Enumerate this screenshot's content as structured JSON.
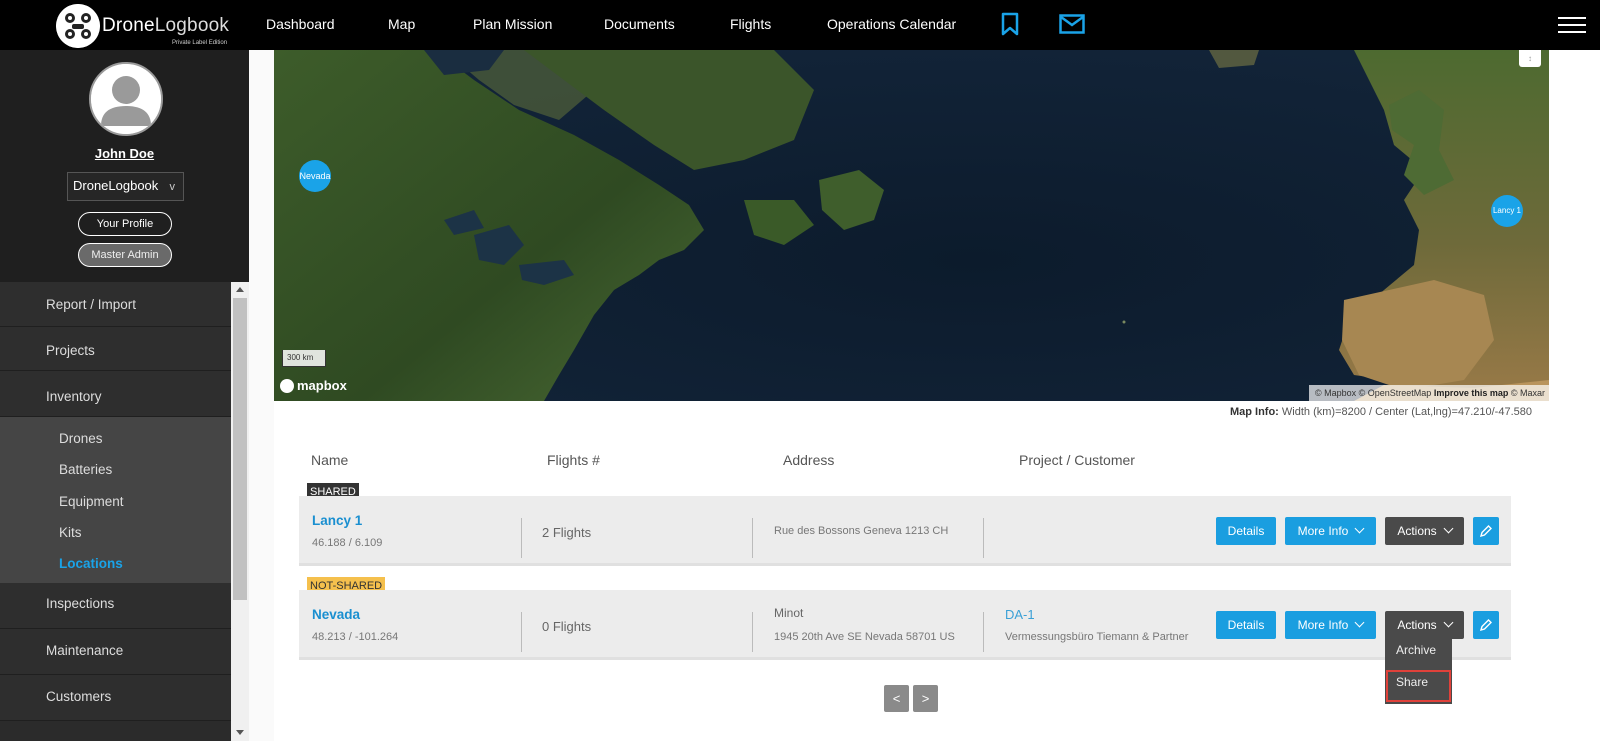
{
  "brand": {
    "name_part1": "Drone",
    "name_part2": "Logbook",
    "edition": "Private Label Edition"
  },
  "nav": {
    "items": [
      "Dashboard",
      "Map",
      "Plan Mission",
      "Documents",
      "Flights",
      "Operations Calendar"
    ]
  },
  "profile": {
    "user_name": "John Doe",
    "organization": "DroneLogbook",
    "org_chevron": "v",
    "your_profile_label": "Your Profile",
    "master_admin_label": "Master Admin"
  },
  "sidebar": {
    "items": [
      "Report / Import",
      "Projects",
      "Inventory"
    ],
    "sub_items": [
      "Drones",
      "Batteries",
      "Equipment",
      "Kits",
      "Locations"
    ],
    "active_sub_item": "Locations",
    "items_after": [
      "Inspections",
      "Maintenance",
      "Customers"
    ]
  },
  "map": {
    "markers": [
      "Nevada",
      "Lancy 1"
    ],
    "scale_label": "300 km",
    "logo_text": "mapbox",
    "attribution_plain": "© Mapbox © OpenStreetMap",
    "attribution_link": "Improve this map",
    "attribution_tail": "© Maxar",
    "compass_symbol": "↕"
  },
  "map_info": {
    "label": "Map Info:",
    "value": "Width (km)=8200 / Center (Lat,lng)=47.210/-47.580"
  },
  "table": {
    "headers": [
      "Name",
      "Flights #",
      "Address",
      "Project / Customer"
    ],
    "rows": [
      {
        "tag": "SHARED",
        "name": "Lancy 1",
        "coords": "46.188 / 6.109",
        "flights": "2 Flights",
        "address_line1": "Rue des Bossons Geneva 1213 CH",
        "address_line2": "",
        "project": "",
        "customer": ""
      },
      {
        "tag": "NOT-SHARED",
        "name": "Nevada",
        "coords": "48.213 / -101.264",
        "flights": "0 Flights",
        "address_line1": "Minot",
        "address_line2": "1945 20th Ave SE Nevada 58701 US",
        "project": "DA-1",
        "customer": "Vermessungsbüro Tiemann & Partner"
      }
    ],
    "buttons": {
      "details": "Details",
      "more_info": "More Info",
      "actions": "Actions"
    }
  },
  "actions_menu": {
    "items": [
      "Archive",
      "Share"
    ]
  },
  "pagination": {
    "prev": "<",
    "next": ">"
  },
  "colors": {
    "accent": "#1a9ee0",
    "shared_tag": "#333333",
    "not_shared_tag": "#f5c04d",
    "highlight": "#e0413a"
  }
}
